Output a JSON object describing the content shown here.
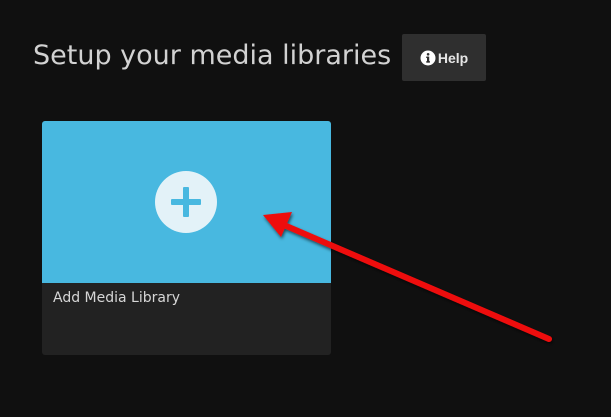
{
  "header": {
    "title": "Setup your media libraries",
    "help_label": "Help",
    "help_icon": "info-circle-icon"
  },
  "cards": [
    {
      "label": "Add Media Library",
      "icon": "plus-icon"
    }
  ],
  "annotation": {
    "type": "arrow",
    "color": "#ee1111"
  },
  "colors": {
    "background": "#101010",
    "card_image": "#48b8e0",
    "card_body": "#222222",
    "button": "#2f2f2f"
  }
}
